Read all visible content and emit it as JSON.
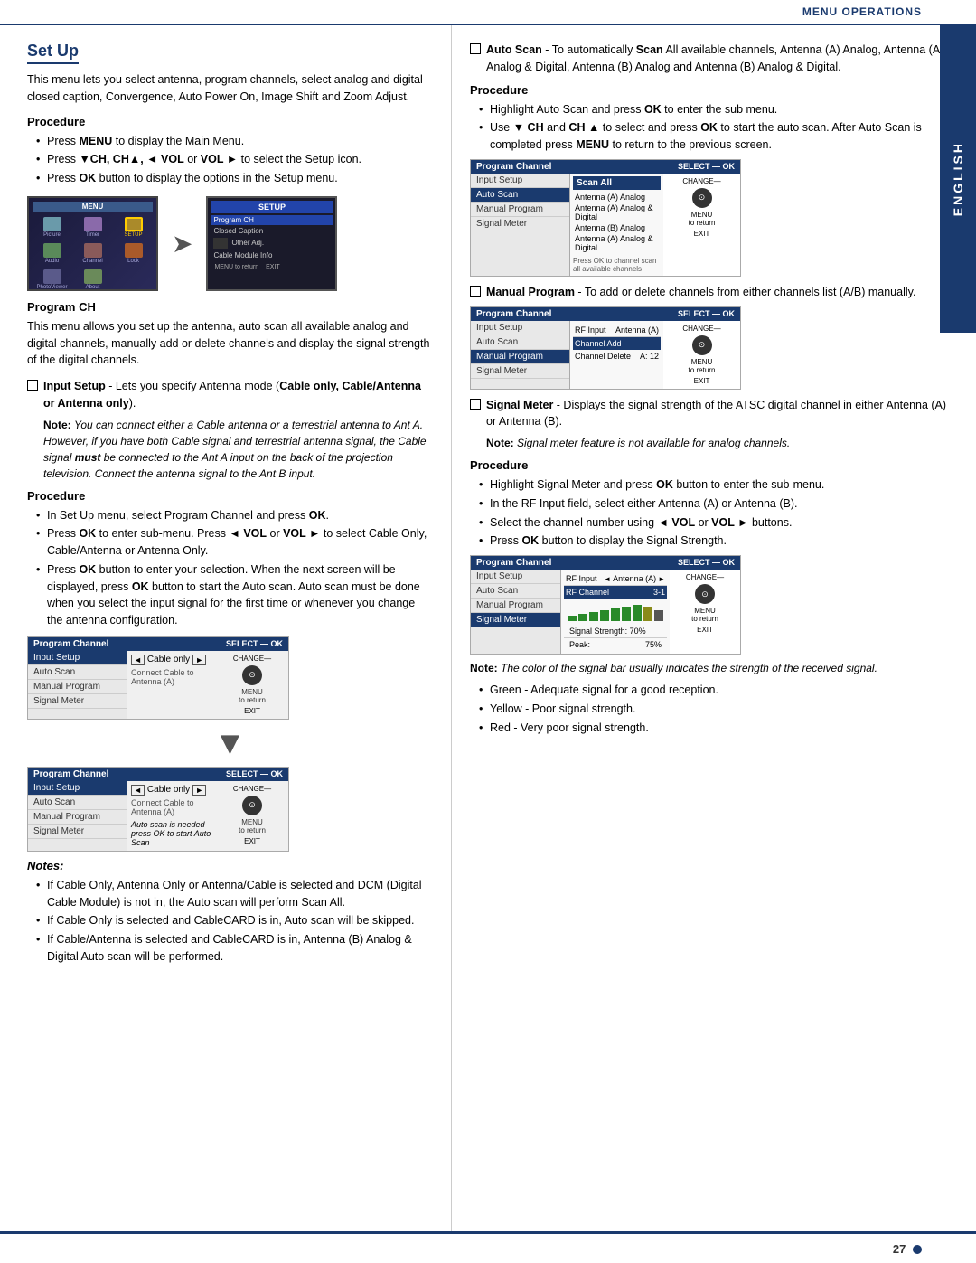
{
  "header": {
    "title": "Menu Operations"
  },
  "page": {
    "number": "27"
  },
  "english_label": "ENGLISH",
  "section": {
    "title": "Set Up",
    "intro": "This menu lets you select antenna, program channels, select analog and digital closed caption, Convergence, Auto Power On, Image Shift and Zoom Adjust.",
    "procedure1": {
      "label": "Procedure",
      "bullets": [
        "Press MENU to display the Main Menu.",
        "Press ▼CH, CH▲, ◄ VOL or VOL ► to select the Setup icon.",
        "Press OK button to display the options in the Setup menu."
      ]
    },
    "program_ch": {
      "title": "Program CH",
      "desc": "This menu allows you set up the antenna, auto scan all available analog and digital channels, manually add or delete channels and display the signal strength of the digital channels.",
      "input_setup": {
        "checkbox_text": "Input Setup - Lets you specify Antenna mode (Cable only, Cable/Antenna or Antenna only).",
        "note_label": "Note:",
        "note_text": "You can connect either a Cable antenna or a terrestrial antenna to Ant A. However, if you have both Cable signal and terrestrial antenna signal, the Cable signal must be connected to the Ant A input on the back of the projection television. Connect the antenna signal to the Ant B input."
      },
      "procedure2": {
        "label": "Procedure",
        "bullets": [
          "In Set Up menu, select Program Channel and press OK.",
          "Press OK to enter sub-menu. Press ◄ VOL or VOL ► to select Cable Only, Cable/Antenna or Antenna Only.",
          "Press OK button to enter your selection. When the next screen will be displayed, press OK button to start the Auto scan. Auto scan must be done when you select the input signal for the first time or whenever you change the antenna configuration."
        ]
      }
    },
    "notes_section": {
      "label": "Notes:",
      "notes": [
        "If Cable Only, Antenna Only or Antenna/Cable is selected and DCM (Digital Cable Module) is not in, the Auto scan will perform Scan All.",
        "If Cable Only is selected and CableCARD is in, Auto scan will be skipped.",
        "If Cable/Antenna is selected and CableCARD is in, Antenna (B) Analog & Digital Auto scan will be performed."
      ]
    },
    "auto_scan": {
      "checkbox_text": "Auto Scan - To automatically Scan All available channels, Antenna (A) Analog, Antenna (A) Analog & Digital, Antenna (B) Analog and Antenna (B) Analog & Digital.",
      "procedure": {
        "label": "Procedure",
        "bullets": [
          "Highlight Auto Scan and press OK to enter the sub menu.",
          "Use ▼ CH and CH ▲ to select and press OK to start the auto scan. After Auto Scan is completed press MENU to return to the previous screen."
        ]
      }
    },
    "manual_program": {
      "checkbox_text": "Manual Program - To add or delete channels from either channels list (A/B) manually."
    },
    "signal_meter": {
      "checkbox_text": "Signal Meter - Displays the signal strength of the ATSC digital channel in either Antenna (A) or Antenna (B).",
      "note_label": "Note:",
      "note_text": "Signal meter feature is not available for analog channels.",
      "procedure": {
        "label": "Procedure",
        "bullets": [
          "Highlight Signal Meter and press OK button to enter the sub-menu.",
          "In the RF Input field, select either Antenna (A) or Antenna (B).",
          "Select the channel number using ◄ VOL or VOL ► buttons.",
          "Press OK button to display the Signal Strength."
        ]
      },
      "note2_label": "Note:",
      "note2_text": "The color of the signal bar usually indicates the strength of the received signal.",
      "color_bullets": [
        "Green - Adequate signal for a good reception.",
        "Yellow - Poor signal strength.",
        "Red - Very poor signal strength."
      ]
    }
  },
  "prog_channel_screen1": {
    "header": "Program Channel",
    "select_ok": "SELECT — OK",
    "change": "CHANGE—",
    "menu_to_return": "MENU to return",
    "exit": "EXIT",
    "menu_items": [
      "Input Setup",
      "Auto Scan",
      "Manual Program",
      "Signal Meter"
    ],
    "active_item": "Input Setup",
    "content": "Cable only",
    "note": "Connect Cable to Antenna (A)"
  },
  "prog_channel_screen2": {
    "header": "Program Channel",
    "menu_items": [
      "Input Setup",
      "Auto Scan",
      "Manual Program",
      "Signal Meter"
    ],
    "active_item": "Input Setup",
    "content": "Cable only",
    "note": "Auto scan is needed\npress OK to start Auto Scan"
  },
  "auto_scan_screen": {
    "header": "Program Channel",
    "select_ok": "SELECT — OK",
    "change": "CHANGE—",
    "menu_to_return": "MENU to return",
    "exit": "EXIT",
    "menu_items": [
      "Input Setup",
      "Auto Scan",
      "Manual Program",
      "Signal Meter"
    ],
    "active_item": "Auto Scan",
    "content_items": [
      "Scan All",
      "Antenna (A) Analog",
      "Antenna (A) Analog & Digital",
      "Antenna (B) Analog",
      "Antenna (A) Analog & Digital"
    ],
    "note": "Press OK to channel scan\nall available channels"
  },
  "manual_prog_screen": {
    "header": "Program Channel",
    "select_ok": "SELECT — OK",
    "change": "CHANGE—",
    "menu_to_return": "MENU to return",
    "exit": "EXIT",
    "menu_items": [
      "Input Setup",
      "Auto Scan",
      "Manual Program",
      "Signal Meter"
    ],
    "active_item": "Manual Program",
    "rf_input_label": "RF Input",
    "rf_input_value": "Antenna (A)",
    "channel_add": "Channel Add",
    "channel_delete": "Channel Delete",
    "channel_value": "A: 12"
  },
  "signal_meter_screen": {
    "header": "Program Channel",
    "select_ok": "SELECT — OK",
    "change": "CHANGE—",
    "menu_to_return": "MENU to return",
    "exit": "EXIT",
    "menu_items": [
      "Input Setup",
      "Auto Scan",
      "Manual Program",
      "Signal Meter"
    ],
    "active_item": "Signal Meter",
    "rf_input_label": "RF Input",
    "rf_input_value": "Antenna (A)",
    "rf_channel_label": "RF Channel",
    "rf_channel_value": "3-1",
    "signal_strength_label": "Signal Strength: 70%",
    "peak_label": "Peak:",
    "peak_value": "75%"
  }
}
